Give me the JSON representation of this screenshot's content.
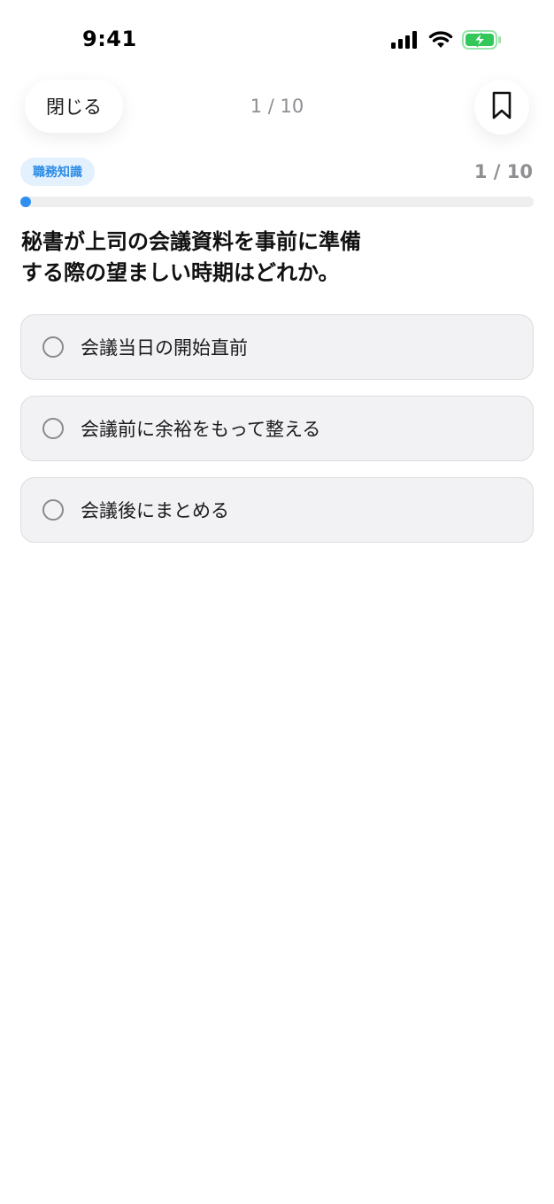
{
  "status_bar": {
    "time": "9:41",
    "icons": [
      "cellular-signal-icon",
      "wifi-icon",
      "battery-charging-icon"
    ],
    "battery_color": "#34c759"
  },
  "nav": {
    "close_label": "閉じる",
    "counter": "1 / 10",
    "bookmark_icon": "bookmark-icon"
  },
  "quiz": {
    "category": "職務知識",
    "progress_label": "1 / 10",
    "progress_fraction": 0.01,
    "question_lines": [
      "秘書が上司の会議資料を事前に準備",
      "する際の望ましい時期はどれか。"
    ],
    "options": [
      {
        "label": "会議当日の開始直前"
      },
      {
        "label": "会議前に余裕をもって整える"
      },
      {
        "label": "会議後にまとめる"
      }
    ]
  },
  "colors": {
    "accent": "#2f8ff0",
    "badge_bg": "#e3f0fd",
    "badge_text": "#2b8ce6",
    "muted_text": "#8e8e93",
    "option_bg": "#f2f2f5"
  }
}
